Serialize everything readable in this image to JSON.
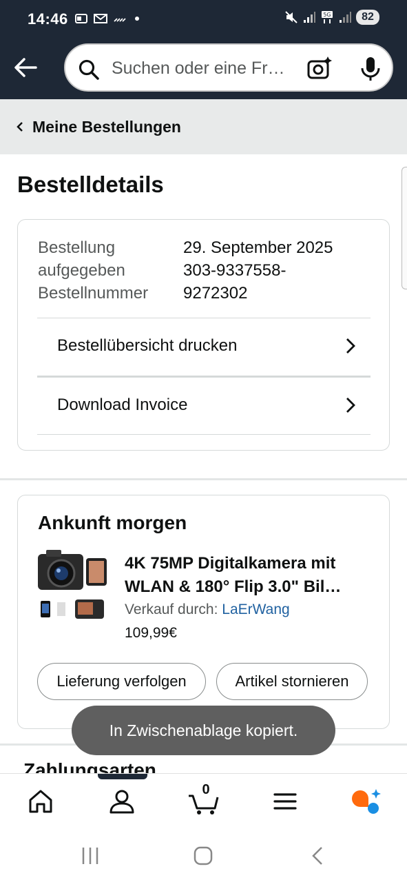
{
  "status_bar": {
    "time": "14:46",
    "battery": "82"
  },
  "search": {
    "placeholder": "Suchen oder eine Fr…"
  },
  "breadcrumb": {
    "label": "Meine Bestellungen"
  },
  "page": {
    "title": "Bestelldetails"
  },
  "order": {
    "placed_label_line1": "Bestellung",
    "placed_label_line2": "aufgegeben",
    "number_label": "Bestellnummer",
    "date": "29. September 2025",
    "number_line1": "303-9337558-",
    "number_line2": "9272302",
    "links": [
      {
        "label": "Bestellübersicht drucken"
      },
      {
        "label": "Download Invoice"
      }
    ]
  },
  "shipment": {
    "arrival": "Ankunft morgen",
    "product": {
      "title_line1": "4K 75MP Digitalkamera mit",
      "title_line2": "WLAN & 180° Flip 3.0\" Bil…",
      "seller_prefix": "Verkauf durch:",
      "seller_name": "LaErWang",
      "price": "109,99€"
    },
    "track_button": "Lieferung verfolgen",
    "cancel_button": "Artikel stornieren"
  },
  "toast": {
    "message": "In Zwischenablage kopiert."
  },
  "next_section": {
    "title": "Zahlungsarten"
  },
  "bottom_nav": {
    "cart_count": "0",
    "active": "account"
  },
  "colors": {
    "header_bg": "#1e2836",
    "link": "#2162a1",
    "toast_bg": "#5f5f5f",
    "rufus_orange": "#ff6a0d",
    "rufus_blue": "#1a8fe3"
  }
}
